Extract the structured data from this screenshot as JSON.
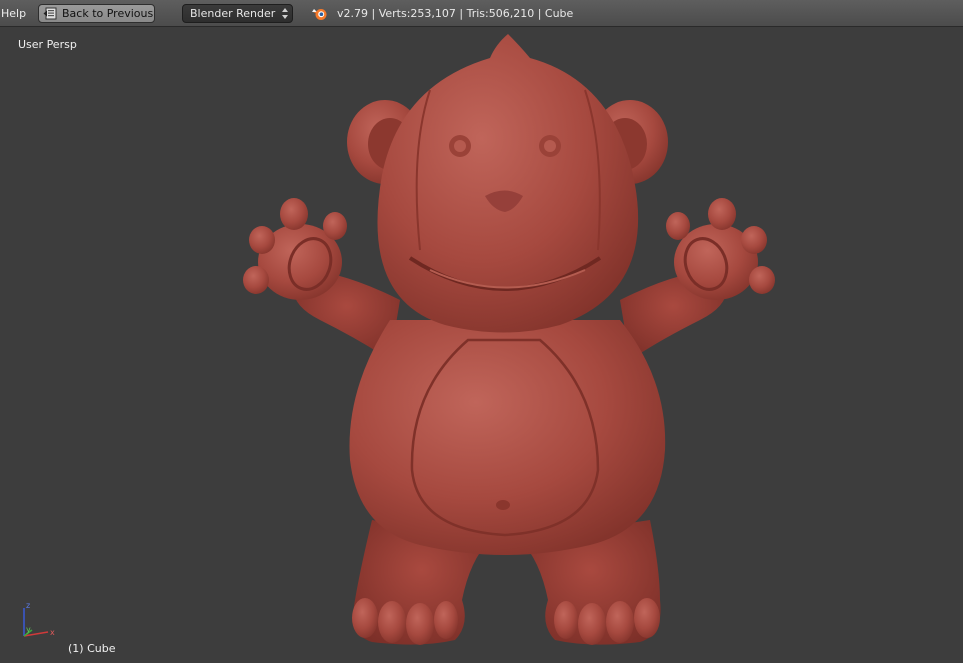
{
  "header": {
    "menu_help": "Help",
    "back_button_label": "Back to Previous",
    "render_engine": "Blender Render",
    "stats": "v2.79 | Verts:253,107 | Tris:506,210 | Cube"
  },
  "viewport": {
    "view_name": "User Persp",
    "object_name": "(1) Cube",
    "model_color": "#a44a40",
    "background_color": "#3d3d3d"
  },
  "axes": {
    "z_label": "z",
    "y_label": "y",
    "x_label": "x"
  }
}
